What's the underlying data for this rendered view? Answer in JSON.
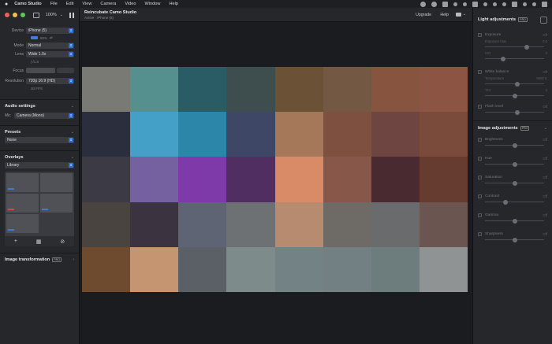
{
  "menubar": {
    "items": [
      "Camo Studio",
      "File",
      "Edit",
      "View",
      "Camera",
      "Video",
      "Window",
      "Help"
    ]
  },
  "titlebar": {
    "zoom": "100%"
  },
  "toolbar": {
    "title": "Reincubate Camo Studio",
    "subtitle": "Active · iPhone (5)",
    "upgrade": "Upgrade",
    "help": "Help"
  },
  "device": {
    "device_label": "Device",
    "device_value": "iPhone (5)",
    "battery": "80%",
    "mode_label": "Mode",
    "mode_value": "Normal",
    "lens_label": "Lens",
    "lens_value": "Wide 1.0x",
    "lens_sub": "ƒ/1.8",
    "focus_label": "Focus",
    "resolution_label": "Resolution",
    "resolution_value": "720p 16:9 (HD)",
    "resolution_sub": "30 FPS"
  },
  "audio": {
    "title": "Audio settings",
    "mic_label": "Mic",
    "mic_value": "Camera (Mono)"
  },
  "presets": {
    "title": "Presets",
    "value": "None"
  },
  "overlays": {
    "title": "Overlays",
    "value": "Library"
  },
  "image_transformation": {
    "title": "Image transformation",
    "badge": "PRO"
  },
  "light_adjustments": {
    "title": "Light adjustments",
    "badge": "PRO",
    "exposure": {
      "label": "Exposure",
      "value": "Off",
      "sub1_label": "Exposure bias",
      "sub1_value": "0.0",
      "sub2_label": "ISO",
      "sub2_value": "0",
      "slider1": 0.7,
      "slider2": 0.3
    },
    "white_balance": {
      "label": "White balance",
      "value": "Off",
      "sub1_label": "Temperature",
      "sub1_value": "5000 K",
      "sub2_label": "Tint",
      "sub2_value": "0",
      "slider1": 0.55,
      "slider2": 0.5
    },
    "flash": {
      "label": "Flash level",
      "value": "Off",
      "slider": 0.55
    }
  },
  "image_adjustments": {
    "title": "Image adjustments",
    "badge": "PRO",
    "items": [
      {
        "label": "Brightness",
        "value": "Off",
        "slider": 0.5
      },
      {
        "label": "Hue",
        "value": "Off",
        "slider": 0.5
      },
      {
        "label": "Saturation",
        "value": "Off",
        "slider": 0.5
      },
      {
        "label": "Contrast",
        "value": "Off",
        "slider": 0.35
      },
      {
        "label": "Gamma",
        "value": "Off",
        "slider": 0.5
      },
      {
        "label": "Sharpness",
        "value": "Off",
        "slider": 0.5
      }
    ]
  },
  "preview_colors": [
    [
      "#7a7a74",
      "#55908f",
      "#2a5c65",
      "#3e4e4f",
      "#6b5237",
      "#735843",
      "#87553f",
      "#8c5543"
    ],
    [
      "#2a2e3d",
      "#45a0c8",
      "#2b86a9",
      "#3f4766",
      "#a5785a",
      "#7d5040",
      "#6e4540",
      "#7a4a3a"
    ],
    [
      "#3c3a44",
      "#7560a0",
      "#7f3aa9",
      "#512e61",
      "#d98a67",
      "#87584a",
      "#4a2a31",
      "#663b30"
    ],
    [
      "#4a4440",
      "#3b3440",
      "#5e6474",
      "#6d7173",
      "#b68b70",
      "#6e6a65",
      "#6a6b6c",
      "#6a5551"
    ],
    [
      "#6e4a2e",
      "#c59571",
      "#5a6066",
      "#7d8b8b",
      "#738284",
      "#728083",
      "#6d7d7d",
      "#8f9394"
    ]
  ]
}
